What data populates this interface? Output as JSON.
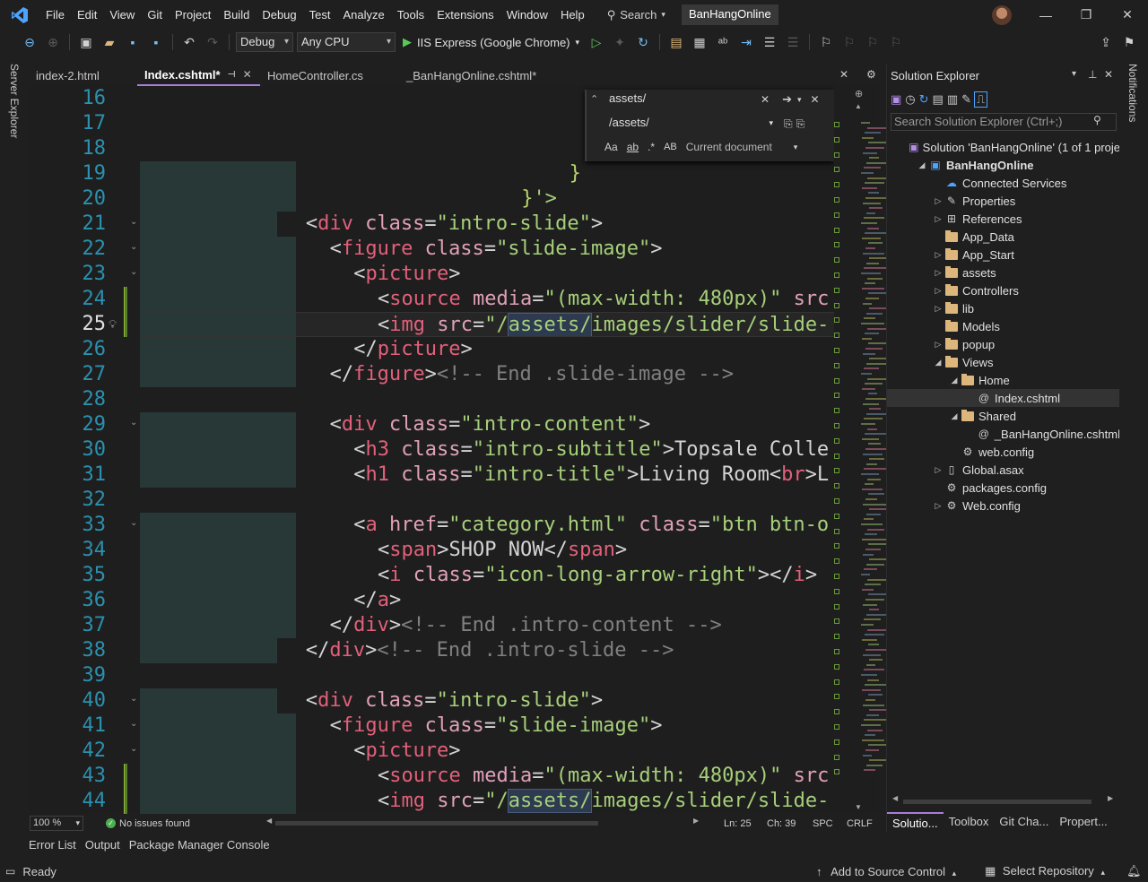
{
  "menu": {
    "items": [
      "File",
      "Edit",
      "View",
      "Git",
      "Project",
      "Build",
      "Debug",
      "Test",
      "Analyze",
      "Tools",
      "Extensions",
      "Window",
      "Help"
    ],
    "search_label": "Search",
    "project_name": "BanHangOnline"
  },
  "toolbar": {
    "config": "Debug",
    "platform": "Any CPU",
    "run_target": "IIS Express (Google Chrome)"
  },
  "left_strip": {
    "label": "Server Explorer"
  },
  "right_strip": {
    "label": "Notifications"
  },
  "tabs": [
    {
      "label": "index-2.html",
      "active": false
    },
    {
      "label": "Index.cshtml*",
      "active": true
    },
    {
      "label": "HomeController.cs",
      "active": false
    },
    {
      "label": "_BanHangOnline.cshtml*",
      "active": false
    }
  ],
  "find": {
    "query": "assets/",
    "replace": "/assets/",
    "scope": "Current document",
    "opt_case": "Aa",
    "opt_word": "ab",
    "opt_regex": ".*",
    "opt_preserve": "AB"
  },
  "editor": {
    "current_line": 25,
    "lines": [
      {
        "n": "16",
        "ind": 0,
        "segs": []
      },
      {
        "n": "17",
        "ind": 0,
        "segs": []
      },
      {
        "n": "18",
        "ind": 0,
        "segs": []
      },
      {
        "n": "19",
        "ind": 18,
        "segs": [
          [
            "brace",
            "}"
          ]
        ]
      },
      {
        "n": "20",
        "ind": 16,
        "segs": [
          [
            "brace",
            "}"
          ],
          [
            "str",
            "'>"
          ]
        ]
      },
      {
        "n": "21",
        "ind": 7,
        "segs": [
          [
            "txt",
            "<"
          ],
          [
            "tag",
            "div"
          ],
          [
            "attr",
            " class"
          ],
          [
            "txt",
            "="
          ],
          [
            "str",
            "\"intro-slide\""
          ],
          [
            "txt",
            ">"
          ]
        ]
      },
      {
        "n": "22",
        "ind": 8,
        "segs": [
          [
            "txt",
            "<"
          ],
          [
            "tag",
            "figure"
          ],
          [
            "attr",
            " class"
          ],
          [
            "txt",
            "="
          ],
          [
            "str",
            "\"slide-image\""
          ],
          [
            "txt",
            ">"
          ]
        ]
      },
      {
        "n": "23",
        "ind": 9,
        "segs": [
          [
            "txt",
            "<"
          ],
          [
            "tag",
            "picture"
          ],
          [
            "txt",
            ">"
          ]
        ]
      },
      {
        "n": "24",
        "ind": 10,
        "segs": [
          [
            "txt",
            "<"
          ],
          [
            "tag",
            "source"
          ],
          [
            "attr",
            " media"
          ],
          [
            "txt",
            "="
          ],
          [
            "str",
            "\"(max-width: 480px)\""
          ],
          [
            "attr",
            " src"
          ]
        ]
      },
      {
        "n": "25",
        "ind": 10,
        "segs": [
          [
            "txt",
            "<"
          ],
          [
            "tag",
            "img"
          ],
          [
            "attr",
            " src"
          ],
          [
            "txt",
            "="
          ],
          [
            "str",
            "\"/"
          ],
          [
            "strhl",
            "assets/"
          ],
          [
            "str",
            "images/slider/slide-"
          ]
        ]
      },
      {
        "n": "26",
        "ind": 9,
        "segs": [
          [
            "txt",
            "</"
          ],
          [
            "tag",
            "picture"
          ],
          [
            "txt",
            ">"
          ]
        ]
      },
      {
        "n": "27",
        "ind": 8,
        "segs": [
          [
            "txt",
            "</"
          ],
          [
            "tag",
            "figure"
          ],
          [
            "txt",
            ">"
          ],
          [
            "com",
            "<!-- End .slide-image -->"
          ]
        ]
      },
      {
        "n": "28",
        "ind": 0,
        "segs": []
      },
      {
        "n": "29",
        "ind": 8,
        "segs": [
          [
            "txt",
            "<"
          ],
          [
            "tag",
            "div"
          ],
          [
            "attr",
            " class"
          ],
          [
            "txt",
            "="
          ],
          [
            "str",
            "\"intro-content\""
          ],
          [
            "txt",
            ">"
          ]
        ]
      },
      {
        "n": "30",
        "ind": 9,
        "segs": [
          [
            "txt",
            "<"
          ],
          [
            "tag",
            "h3"
          ],
          [
            "attr",
            " class"
          ],
          [
            "txt",
            "="
          ],
          [
            "str",
            "\"intro-subtitle\""
          ],
          [
            "txt",
            ">Topsale Colle"
          ]
        ]
      },
      {
        "n": "31",
        "ind": 9,
        "segs": [
          [
            "txt",
            "<"
          ],
          [
            "tag",
            "h1"
          ],
          [
            "attr",
            " class"
          ],
          [
            "txt",
            "="
          ],
          [
            "str",
            "\"intro-title\""
          ],
          [
            "txt",
            ">Living Room<"
          ],
          [
            "tag",
            "br"
          ],
          [
            "txt",
            ">L"
          ]
        ]
      },
      {
        "n": "32",
        "ind": 0,
        "segs": []
      },
      {
        "n": "33",
        "ind": 9,
        "segs": [
          [
            "txt",
            "<"
          ],
          [
            "tag",
            "a"
          ],
          [
            "attr",
            " href"
          ],
          [
            "txt",
            "="
          ],
          [
            "str",
            "\"category.html\""
          ],
          [
            "attr",
            " class"
          ],
          [
            "txt",
            "="
          ],
          [
            "str",
            "\"btn btn-o"
          ]
        ]
      },
      {
        "n": "34",
        "ind": 10,
        "segs": [
          [
            "txt",
            "<"
          ],
          [
            "tag",
            "span"
          ],
          [
            "txt",
            ">SHOP NOW</"
          ],
          [
            "tag",
            "span"
          ],
          [
            "txt",
            ">"
          ]
        ]
      },
      {
        "n": "35",
        "ind": 10,
        "segs": [
          [
            "txt",
            "<"
          ],
          [
            "tag",
            "i"
          ],
          [
            "attr",
            " class"
          ],
          [
            "txt",
            "="
          ],
          [
            "str",
            "\"icon-long-arrow-right\""
          ],
          [
            "txt",
            "></"
          ],
          [
            "tag",
            "i"
          ],
          [
            "txt",
            ">"
          ]
        ]
      },
      {
        "n": "36",
        "ind": 9,
        "segs": [
          [
            "txt",
            "</"
          ],
          [
            "tag",
            "a"
          ],
          [
            "txt",
            ">"
          ]
        ]
      },
      {
        "n": "37",
        "ind": 8,
        "segs": [
          [
            "txt",
            "</"
          ],
          [
            "tag",
            "div"
          ],
          [
            "txt",
            ">"
          ],
          [
            "com",
            "<!-- End .intro-content -->"
          ]
        ]
      },
      {
        "n": "38",
        "ind": 7,
        "segs": [
          [
            "txt",
            "</"
          ],
          [
            "tag",
            "div"
          ],
          [
            "txt",
            ">"
          ],
          [
            "com",
            "<!-- End .intro-slide -->"
          ]
        ]
      },
      {
        "n": "39",
        "ind": 0,
        "segs": []
      },
      {
        "n": "40",
        "ind": 7,
        "segs": [
          [
            "txt",
            "<"
          ],
          [
            "tag",
            "div"
          ],
          [
            "attr",
            " class"
          ],
          [
            "txt",
            "="
          ],
          [
            "str",
            "\"intro-slide\""
          ],
          [
            "txt",
            ">"
          ]
        ]
      },
      {
        "n": "41",
        "ind": 8,
        "segs": [
          [
            "txt",
            "<"
          ],
          [
            "tag",
            "figure"
          ],
          [
            "attr",
            " class"
          ],
          [
            "txt",
            "="
          ],
          [
            "str",
            "\"slide-image\""
          ],
          [
            "txt",
            ">"
          ]
        ]
      },
      {
        "n": "42",
        "ind": 9,
        "segs": [
          [
            "txt",
            "<"
          ],
          [
            "tag",
            "picture"
          ],
          [
            "txt",
            ">"
          ]
        ]
      },
      {
        "n": "43",
        "ind": 10,
        "segs": [
          [
            "txt",
            "<"
          ],
          [
            "tag",
            "source"
          ],
          [
            "attr",
            " media"
          ],
          [
            "txt",
            "="
          ],
          [
            "str",
            "\"(max-width: 480px)\""
          ],
          [
            "attr",
            " src"
          ]
        ]
      },
      {
        "n": "44",
        "ind": 10,
        "segs": [
          [
            "txt",
            "<"
          ],
          [
            "tag",
            "img"
          ],
          [
            "attr",
            " src"
          ],
          [
            "txt",
            "="
          ],
          [
            "str",
            "\"/"
          ],
          [
            "strhl",
            "assets/"
          ],
          [
            "str",
            "images/slider/slide-"
          ]
        ]
      }
    ]
  },
  "editor_status": {
    "zoom": "100 %",
    "issues": "No issues found",
    "ln": "Ln: 25",
    "ch": "Ch: 39",
    "spc": "SPC",
    "eol": "CRLF"
  },
  "solution": {
    "title": "Solution Explorer",
    "search_placeholder": "Search Solution Explorer (Ctrl+;)",
    "tree": [
      {
        "label": "Solution 'BanHangOnline' (1 of 1 proje",
        "level": 0,
        "exp": "",
        "icon": "solution-icon"
      },
      {
        "label": "BanHangOnline",
        "level": 1,
        "exp": "open",
        "icon": "project-icon",
        "bold": true
      },
      {
        "label": "Connected Services",
        "level": 2,
        "exp": "",
        "icon": "connected-services-icon"
      },
      {
        "label": "Properties",
        "level": 2,
        "exp": "closed",
        "icon": "wrench-icon"
      },
      {
        "label": "References",
        "level": 2,
        "exp": "closed",
        "icon": "references-icon"
      },
      {
        "label": "App_Data",
        "level": 2,
        "exp": "",
        "icon": "folder-icon"
      },
      {
        "label": "App_Start",
        "level": 2,
        "exp": "closed",
        "icon": "folder-icon"
      },
      {
        "label": "assets",
        "level": 2,
        "exp": "closed",
        "icon": "folder-icon"
      },
      {
        "label": "Controllers",
        "level": 2,
        "exp": "closed",
        "icon": "folder-icon"
      },
      {
        "label": "lib",
        "level": 2,
        "exp": "closed",
        "icon": "folder-icon"
      },
      {
        "label": "Models",
        "level": 2,
        "exp": "",
        "icon": "folder-icon"
      },
      {
        "label": "popup",
        "level": 2,
        "exp": "closed",
        "icon": "folder-icon"
      },
      {
        "label": "Views",
        "level": 2,
        "exp": "open",
        "icon": "folder-icon"
      },
      {
        "label": "Home",
        "level": 3,
        "exp": "open",
        "icon": "folder-icon"
      },
      {
        "label": "Index.cshtml",
        "level": 4,
        "exp": "",
        "icon": "cshtml-file-icon",
        "selected": true
      },
      {
        "label": "Shared",
        "level": 3,
        "exp": "open",
        "icon": "folder-icon"
      },
      {
        "label": "_BanHangOnline.cshtml",
        "level": 4,
        "exp": "",
        "icon": "cshtml-file-icon"
      },
      {
        "label": "web.config",
        "level": 3,
        "exp": "",
        "icon": "config-file-icon"
      },
      {
        "label": "Global.asax",
        "level": 2,
        "exp": "closed",
        "icon": "file-icon"
      },
      {
        "label": "packages.config",
        "level": 2,
        "exp": "",
        "icon": "config-file-icon"
      },
      {
        "label": "Web.config",
        "level": 2,
        "exp": "closed",
        "icon": "config-file-icon"
      }
    ],
    "tabs": [
      "Solutio...",
      "Toolbox",
      "Git Cha...",
      "Propert..."
    ]
  },
  "tool_tabs": [
    "Error List",
    "Output",
    "Package Manager Console"
  ],
  "statusbar": {
    "ready": "Ready",
    "source_control": "Add to Source Control",
    "repo": "Select Repository"
  },
  "colors": {
    "accent": "#a87ed8",
    "tag": "#e2607a",
    "string": "#a6d07a",
    "comment": "#808080",
    "line_number": "#2b91af"
  }
}
